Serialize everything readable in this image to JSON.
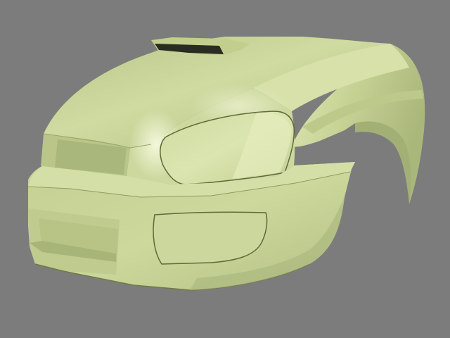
{
  "scene": {
    "subject": "car-front-body-shell-3d-model",
    "colors": {
      "background": "#7c7c7c",
      "body_base": "#c9d59a",
      "body_light": "#e6edbf",
      "body_highlight": "#f2f6d8",
      "body_shadow": "#a6b478",
      "body_dark_shadow": "#8f9c61",
      "recess_dark": "#2a2c22",
      "edge_line": "#6f7a45"
    }
  }
}
